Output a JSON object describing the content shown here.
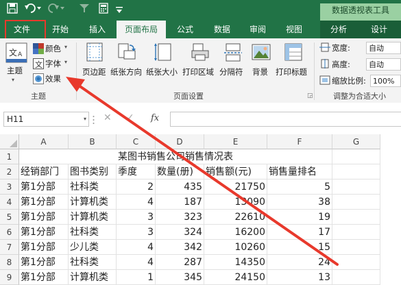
{
  "title_bar": {
    "save_icon": "save-icon",
    "undo_icon": "undo-icon",
    "redo_icon": "redo-icon",
    "context_title": "数据透视表工具"
  },
  "tabs": {
    "file": "文件",
    "home": "开始",
    "insert": "插入",
    "page_layout": "页面布局",
    "formulas": "公式",
    "data": "数据",
    "review": "审阅",
    "view": "视图",
    "analyze": "分析",
    "design": "设计"
  },
  "ribbon": {
    "theme_label": "主题",
    "colors_label": "颜色",
    "fonts_label": "字体",
    "effects_label": "效果",
    "group_theme": "主题",
    "margins": "页边距",
    "orientation": "纸张方向",
    "size": "纸张大小",
    "print_area": "打印区域",
    "breaks": "分隔符",
    "background": "背景",
    "print_titles": "打印标题",
    "group_page_setup": "页面设置",
    "width_label": "宽度:",
    "height_label": "高度:",
    "scale_label": "缩放比例:",
    "width_value": "自动",
    "height_value": "自动",
    "scale_value": "100%",
    "group_fit": "调整为合适大小"
  },
  "formula_bar": {
    "name_box": "H11",
    "cancel_symbol": "✕",
    "enter_symbol": "✓",
    "fx_symbol": "fx",
    "formula": ""
  },
  "sheet": {
    "columns": [
      "A",
      "B",
      "C",
      "D",
      "E",
      "F",
      "G"
    ],
    "rows": [
      "1",
      "2",
      "3",
      "4",
      "5",
      "6",
      "7",
      "8",
      "9"
    ],
    "title": "某图书销售公司销售情况表",
    "headers": [
      "经销部门",
      "图书类别",
      "季度",
      "数量(册)",
      "销售额(元)",
      "销售量排名"
    ],
    "data": [
      [
        "第1分部",
        "社科类",
        "2",
        "435",
        "21750",
        "5"
      ],
      [
        "第1分部",
        "计算机类",
        "4",
        "187",
        "13090",
        "38"
      ],
      [
        "第1分部",
        "计算机类",
        "3",
        "323",
        "22610",
        "19"
      ],
      [
        "第1分部",
        "社科类",
        "3",
        "324",
        "16200",
        "17"
      ],
      [
        "第1分部",
        "少儿类",
        "4",
        "342",
        "10260",
        "15"
      ],
      [
        "第1分部",
        "社科类",
        "4",
        "287",
        "14350",
        "24"
      ],
      [
        "第1分部",
        "计算机类",
        "1",
        "345",
        "24150",
        "13"
      ]
    ]
  },
  "annotation": {
    "highlight_color": "#e8392c",
    "arrow_color": "#e8392c"
  }
}
